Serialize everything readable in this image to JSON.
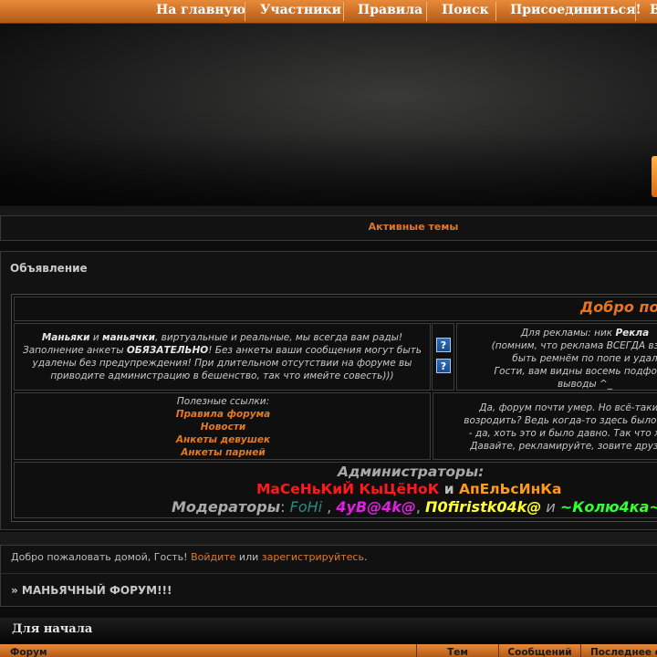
{
  "nav": {
    "items": [
      "На главную",
      "Участники",
      "Правила",
      "Поиск",
      "Присоединиться!",
      "В"
    ]
  },
  "active_topics": "Активные темы",
  "announcement": {
    "title": "Объявление",
    "welcome_heading": "Добро по",
    "left_text": {
      "w1": "Маньяки",
      "w2": " и ",
      "w3": "маньячки",
      "w4": ", виртуальные и реальные, мы всегда вам рады! Заполнение анкеты ",
      "w5": "ОБЯЗАТЕЛЬНО",
      "w6": "! Без анкеты ваши сообщения могут быть удалены без предупреждения! При длительном отсутствии на форуме вы приводите администрацию в бешенство, так что имейте совесть)))"
    },
    "right_text": {
      "l1a": "Для рекламы: ник ",
      "l1b": "Рекла",
      "l2": "(помним, что реклама ВСЕГДА взаим",
      "l3": "быть ремнём по попе и удал",
      "l4": "Гости, вам видны восемь подфорум",
      "l5": "выводы ^_"
    },
    "links_label": "Полезные ссылки:",
    "links": [
      "Правила форума",
      "Новости",
      "Анкеты девушек",
      "Анкеты парней"
    ],
    "bottom_right": {
      "l1": "Да, форум почти умер. Но всё-таки, ",
      "l2": "возродить? Ведь когда-то здесь было акт",
      "l3": "- да, хоть это и было давно. Так что же, ",
      "l4": "Давайте, рекламируйте, зовите друзей"
    },
    "staff": {
      "admins_label": "Администраторы:",
      "admin1": "МаСеНьКиЙ КыЦёНоК",
      "and1": " и ",
      "admin2": "АпЕлЬсИнКа",
      "mods_label": "Модераторы",
      "colon": ": ",
      "mod1": "FoHi",
      "sep1": " , ",
      "mod2": "4уВ@4k@",
      "sep2": ", ",
      "mod3": "П0firistk04k@",
      "and2": " и ",
      "mod4": "~Колю4ка~"
    }
  },
  "greeting": {
    "text_before": "Добро пожаловать домой, Гость! ",
    "login": "Войдите",
    "or": " или ",
    "register": "зарегистрируйтесь",
    "end": "."
  },
  "forum_title": "» МАНЬЯЧНЫЙ ФОРУМ!!!",
  "category": "Для начала",
  "columns": [
    "Форум",
    "Тем",
    "Сообщений",
    "Последнее с"
  ],
  "colors": {
    "accent": "#e3782a",
    "admin1": "#ff1a1a",
    "admin2": "#ff9a1a",
    "mod1": "#2a8a8a",
    "mod2": "#e020e0",
    "mod3": "#ffff33",
    "mod4": "#33ff33"
  }
}
